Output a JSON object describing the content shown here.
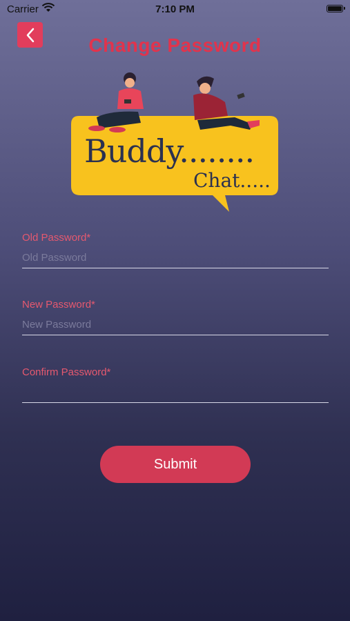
{
  "status_bar": {
    "carrier": "Carrier",
    "time": "7:10 PM"
  },
  "header": {
    "title": "Change Password",
    "back_icon": "chevron-left-icon"
  },
  "logo": {
    "line1": "Buddy........",
    "line2": "Chat....."
  },
  "form": {
    "fields": [
      {
        "label": "Old Password*",
        "placeholder": "Old Password",
        "value": ""
      },
      {
        "label": "New Password*",
        "placeholder": "New Password",
        "value": ""
      },
      {
        "label": "Confirm Password*",
        "placeholder": "",
        "value": ""
      }
    ],
    "submit_label": "Submit"
  },
  "colors": {
    "accent": "#e23d5c",
    "title": "#e2334c",
    "label": "#e6596f",
    "logo_bubble": "#f8c21e"
  }
}
